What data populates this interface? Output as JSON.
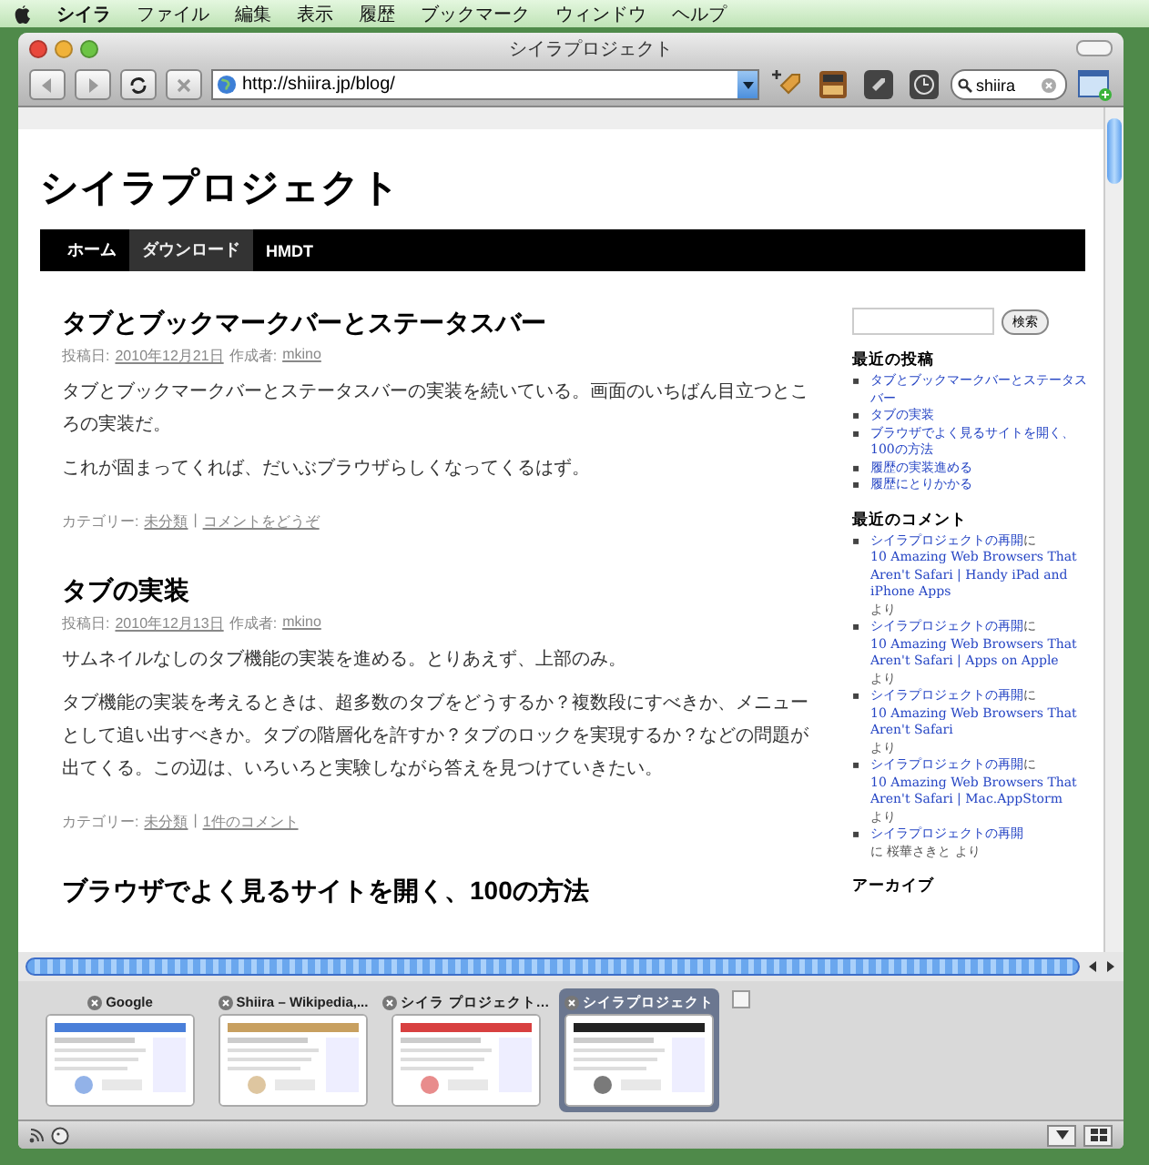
{
  "menubar": [
    "シイラ",
    "ファイル",
    "編集",
    "表示",
    "履歴",
    "ブックマーク",
    "ウィンドウ",
    "ヘルプ"
  ],
  "window": {
    "title": "シイラプロジェクト"
  },
  "toolbar": {
    "url": "http://shiira.jp/blog/",
    "search": "shiira"
  },
  "site": {
    "title": "シイラプロジェクト",
    "nav": [
      {
        "label": "ホーム",
        "selected": false
      },
      {
        "label": "ダウンロード",
        "selected": true
      },
      {
        "label": "HMDT",
        "selected": false
      }
    ]
  },
  "posts": [
    {
      "title": "タブとブックマークバーとステータスバー",
      "date_label": "投稿日:",
      "date": "2010年12月21日",
      "author_label": "作成者:",
      "author": "mkino",
      "paragraphs": [
        "タブとブックマークバーとステータスバーの実装を続いている。画面のいちばん目立つところの実装だ。",
        "これが固まってくれば、だいぶブラウザらしくなってくるはず。"
      ],
      "category_label": "カテゴリー:",
      "category": "未分類",
      "separator": "|",
      "comments": "コメントをどうぞ"
    },
    {
      "title": "タブの実装",
      "date_label": "投稿日:",
      "date": "2010年12月13日",
      "author_label": "作成者:",
      "author": "mkino",
      "paragraphs": [
        "サムネイルなしのタブ機能の実装を進める。とりあえず、上部のみ。",
        "タブ機能の実装を考えるときは、超多数のタブをどうするか？複数段にすべきか、メニューとして追い出すべきか。タブの階層化を許すか？タブのロックを実現するか？などの問題が出てくる。この辺は、いろいろと実験しながら答えを見つけていきたい。"
      ],
      "category_label": "カテゴリー:",
      "category": "未分類",
      "separator": "|",
      "comments": "1件のコメント"
    },
    {
      "title": "ブラウザでよく見るサイトを開く、100の方法"
    }
  ],
  "sidebar": {
    "search_button": "検索",
    "bullet": "▪",
    "recent_posts": {
      "heading": "最近の投稿",
      "items": [
        "タブとブックマークバーとステータスバー",
        "タブの実装",
        "ブラウザでよく見るサイトを開く、100の方法",
        "履歴の実装進める",
        "履歴にとりかかる"
      ]
    },
    "recent_comments": {
      "heading": "最近のコメント",
      "items": [
        {
          "parts": [
            {
              "text": "シイラプロジェクトの再開",
              "link": true
            },
            {
              "text": " に ",
              "link": false
            },
            {
              "text": "10 Amazing Web Browsers That Aren't Safari | Handy iPad and iPhone Apps",
              "link": true
            },
            {
              "text": " より",
              "link": false
            }
          ]
        },
        {
          "parts": [
            {
              "text": "シイラプロジェクトの再開",
              "link": true
            },
            {
              "text": " に ",
              "link": false
            },
            {
              "text": "10 Amazing Web Browsers That Aren't Safari | Apps on Apple",
              "link": true
            },
            {
              "text": " より",
              "link": false
            }
          ]
        },
        {
          "parts": [
            {
              "text": "シイラプロジェクトの再開",
              "link": true
            },
            {
              "text": " に ",
              "link": false
            },
            {
              "text": "10 Amazing Web Browsers That Aren't Safari",
              "link": true
            },
            {
              "text": " より",
              "link": false
            }
          ]
        },
        {
          "parts": [
            {
              "text": "シイラプロジェクトの再開",
              "link": true
            },
            {
              "text": " に ",
              "link": false
            },
            {
              "text": "10 Amazing Web Browsers That Aren't Safari | Mac.AppStorm",
              "link": true
            },
            {
              "text": " より",
              "link": false
            }
          ]
        },
        {
          "parts": [
            {
              "text": "シイラプロジェクトの再開",
              "link": true
            },
            {
              "text": " に 桜華さきと より",
              "link": false
            }
          ]
        }
      ]
    },
    "archive_heading": "アーカイブ"
  },
  "tabs": [
    {
      "title": "Google",
      "selected": false
    },
    {
      "title": "Shiira – Wikipedia,...",
      "selected": false
    },
    {
      "title": "シイラ プロジェクト…",
      "selected": false
    },
    {
      "title": "シイラプロジェクト",
      "selected": true
    }
  ]
}
